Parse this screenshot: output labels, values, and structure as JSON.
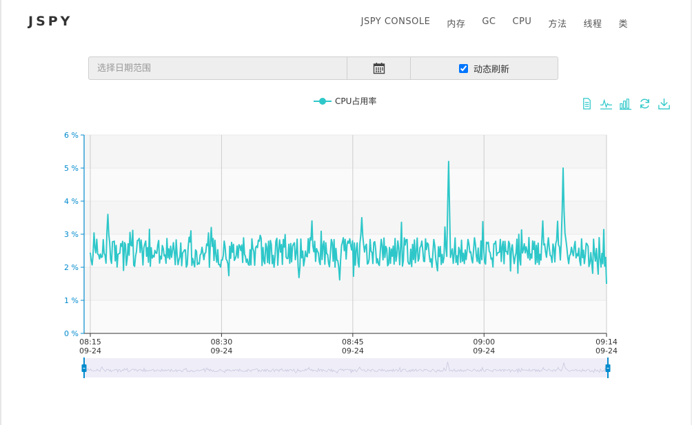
{
  "brand": "JSPY",
  "nav": [
    {
      "label": "JSPY CONSOLE"
    },
    {
      "label": "内存"
    },
    {
      "label": "GC"
    },
    {
      "label": "CPU"
    },
    {
      "label": "方法"
    },
    {
      "label": "线程"
    },
    {
      "label": "类"
    }
  ],
  "filter": {
    "date_placeholder": "选择日期范围",
    "date_value": "",
    "auto_refresh_label": "动态刷新",
    "auto_refresh_checked": true
  },
  "toolbox": [
    "data-view-icon",
    "line-chart-icon",
    "bar-chart-icon",
    "restore-icon",
    "save-image-icon"
  ],
  "colors": {
    "series": "#2ec7c9",
    "axis": "#008acd",
    "zoom_fill": "#efedf7",
    "zoom_handle": "#008acd"
  },
  "chart_data": {
    "type": "line",
    "title": "",
    "xlabel": "",
    "ylabel": "",
    "legend": "top-center",
    "ylim": [
      0,
      6
    ],
    "y_ticks": [
      "0 %",
      "1 %",
      "2 %",
      "3 %",
      "4 %",
      "5 %",
      "6 %"
    ],
    "x_range": [
      "08:15",
      "09:14"
    ],
    "x_ticks": [
      {
        "time": "08:15",
        "date": "09-24"
      },
      {
        "time": "08:30",
        "date": "09-24"
      },
      {
        "time": "08:45",
        "date": "09-24"
      },
      {
        "time": "09:00",
        "date": "09-24"
      },
      {
        "time": "09:14",
        "date": "09-24"
      }
    ],
    "series": [
      {
        "name": "CPU占用率",
        "unit": "%",
        "typical_range": [
          1.6,
          3.4
        ],
        "peaks": [
          {
            "x": "08:17",
            "y": 3.6
          },
          {
            "x": "08:46",
            "y": 3.5
          },
          {
            "x": "08:56",
            "y": 5.2
          },
          {
            "x": "09:09",
            "y": 5.0
          }
        ],
        "last": {
          "x": "09:14",
          "y": 1.5
        }
      }
    ],
    "grid": true,
    "data_zoom": {
      "start": 0,
      "end": 100
    }
  }
}
